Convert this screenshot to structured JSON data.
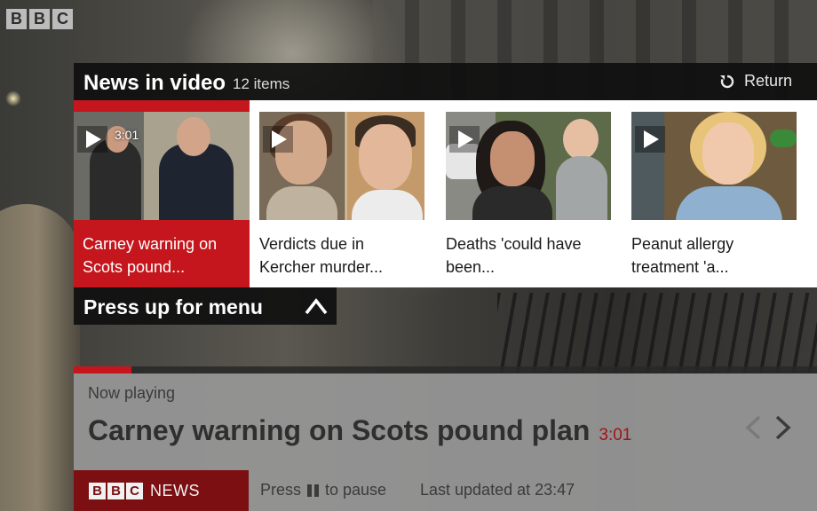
{
  "brand": {
    "logo_letters": [
      "B",
      "B",
      "C"
    ],
    "news_logo_letters": [
      "B",
      "B",
      "C"
    ],
    "news_word": "NEWS"
  },
  "header": {
    "title": "News in video",
    "count": "12 items",
    "return_label": "Return"
  },
  "carousel": {
    "selected_index": 0,
    "items": [
      {
        "title_line1": "Carney warning on",
        "title_line2": "Scots pound...",
        "duration": "3:01"
      },
      {
        "title_line1": "Verdicts due in",
        "title_line2": "Kercher murder...",
        "duration": ""
      },
      {
        "title_line1": "Deaths 'could have",
        "title_line2": "been...",
        "duration": ""
      },
      {
        "title_line1": "Peanut allergy",
        "title_line2": "treatment 'a...",
        "duration": ""
      }
    ]
  },
  "menu_hint": {
    "label": "Press up for menu"
  },
  "player": {
    "progress_fraction": 0.078,
    "now_playing_label": "Now playing",
    "title": "Carney warning on Scots pound plan",
    "duration": "3:01",
    "pause_hint_prefix": "Press",
    "pause_hint_suffix": "to pause",
    "last_updated": "Last updated at 23:47"
  },
  "colors": {
    "accent_red": "#c4161c",
    "news_red": "#7b0f12"
  }
}
